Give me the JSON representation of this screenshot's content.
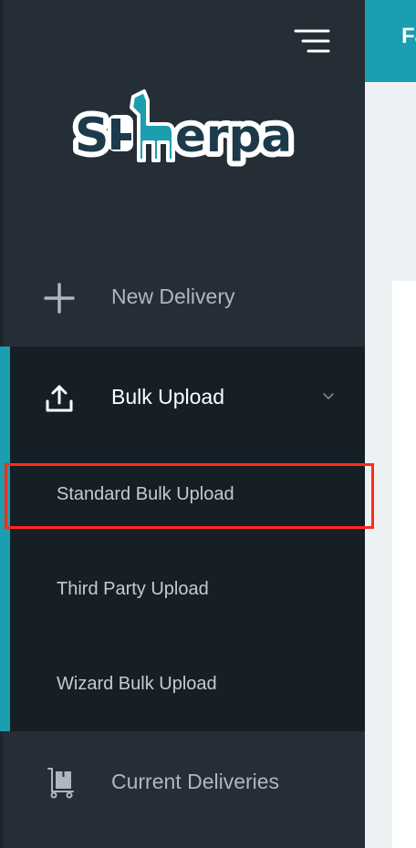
{
  "topbar": {
    "title_fragment": "Fa"
  },
  "brand": {
    "logo_text": "Sherpa"
  },
  "sidebar": {
    "items": [
      {
        "label": "New Delivery",
        "icon": "plus-icon"
      },
      {
        "label": "Bulk Upload",
        "icon": "upload-icon",
        "expanded": true,
        "children": [
          {
            "label": "Standard Bulk Upload",
            "highlighted": true
          },
          {
            "label": "Third Party Upload"
          },
          {
            "label": "Wizard Bulk Upload"
          }
        ]
      },
      {
        "label": "Current Deliveries",
        "icon": "dolly-boxes-icon"
      }
    ]
  },
  "colors": {
    "sidebar_bg": "#252e36",
    "active_section_bg": "#161f26",
    "accent": "#1b9eb0",
    "highlight": "#ff2a1a"
  }
}
